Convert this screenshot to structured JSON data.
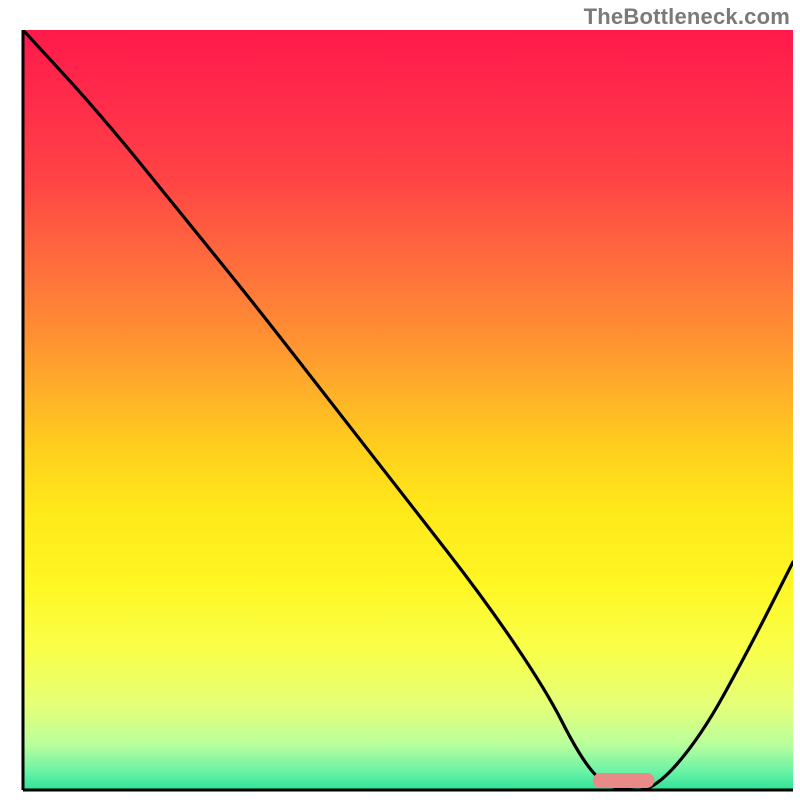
{
  "watermark": "TheBottleneck.com",
  "chart_data": {
    "type": "line",
    "title": "",
    "xlabel": "",
    "ylabel": "",
    "xlim": [
      0,
      100
    ],
    "ylim": [
      0,
      100
    ],
    "grid": false,
    "legend": false,
    "background_gradient": {
      "stops": [
        {
          "offset": 0.0,
          "color": "#ff1a4b"
        },
        {
          "offset": 0.1,
          "color": "#ff2d4a"
        },
        {
          "offset": 0.2,
          "color": "#ff4545"
        },
        {
          "offset": 0.3,
          "color": "#ff6a3d"
        },
        {
          "offset": 0.4,
          "color": "#ff8f33"
        },
        {
          "offset": 0.48,
          "color": "#ffb128"
        },
        {
          "offset": 0.55,
          "color": "#ffcf1d"
        },
        {
          "offset": 0.63,
          "color": "#ffe81a"
        },
        {
          "offset": 0.73,
          "color": "#fff724"
        },
        {
          "offset": 0.82,
          "color": "#f8ff4c"
        },
        {
          "offset": 0.89,
          "color": "#e4ff79"
        },
        {
          "offset": 0.94,
          "color": "#b9ff9c"
        },
        {
          "offset": 0.975,
          "color": "#6cf3a6"
        },
        {
          "offset": 1.0,
          "color": "#2de39a"
        }
      ]
    },
    "x": [
      0,
      10,
      22,
      30,
      40,
      50,
      60,
      68,
      72,
      75,
      78,
      82,
      88,
      94,
      100
    ],
    "values": [
      100,
      89,
      74,
      64,
      51,
      38,
      25,
      13,
      5,
      1,
      0,
      0,
      7,
      18,
      30
    ],
    "optimum_marker": {
      "x_range": [
        74,
        82
      ],
      "y": 0,
      "color": "#e88a87"
    }
  }
}
